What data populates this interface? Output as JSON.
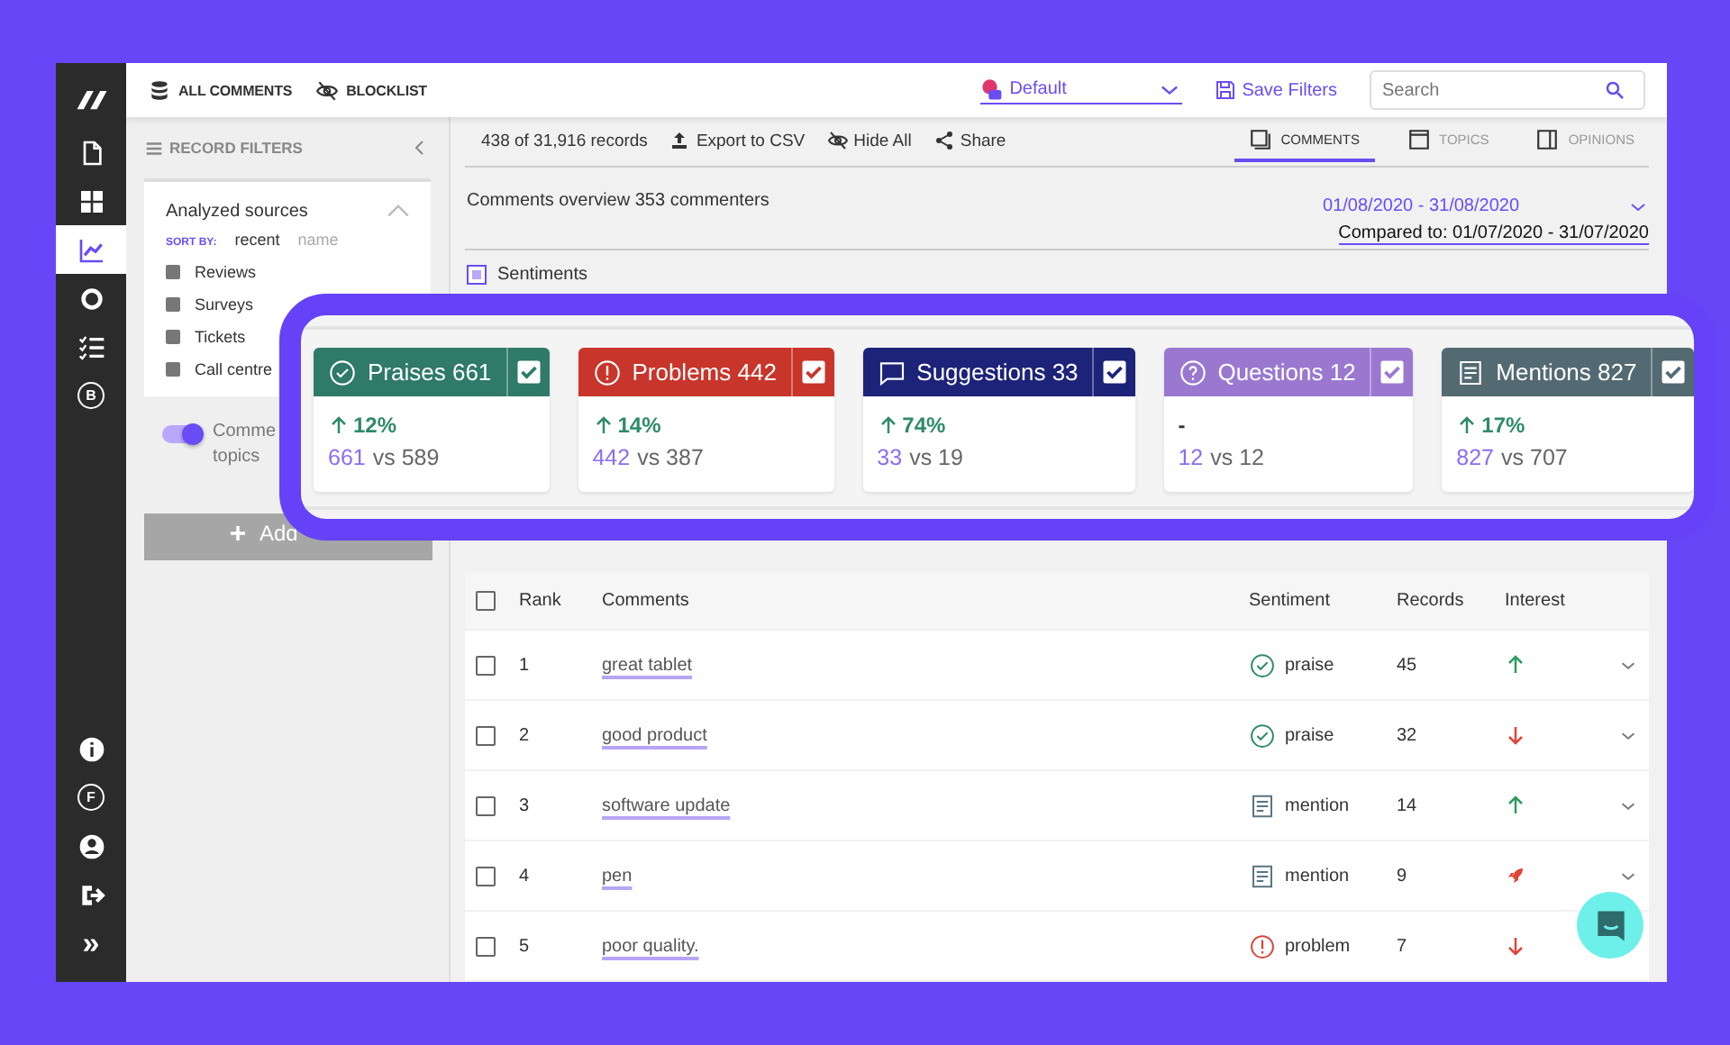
{
  "nav": {
    "top": [
      {
        "kind": "logo",
        "selected": false
      },
      {
        "kind": "document",
        "selected": false
      },
      {
        "kind": "grid",
        "selected": false
      },
      {
        "kind": "chart",
        "selected": true
      },
      {
        "kind": "ring",
        "selected": false
      },
      {
        "kind": "checklist",
        "selected": false
      },
      {
        "kind": "letter",
        "letter": "B",
        "selected": false
      }
    ],
    "bottom": [
      {
        "kind": "info",
        "selected": false
      },
      {
        "kind": "letter",
        "letter": "F",
        "selected": false
      },
      {
        "kind": "user",
        "selected": false
      },
      {
        "kind": "logout",
        "selected": false
      },
      {
        "kind": "text",
        "text": "»",
        "selected": false
      }
    ]
  },
  "topbar": {
    "links": [
      {
        "kind": "database",
        "label": "ALL COMMENTS"
      },
      {
        "kind": "eye-off",
        "label": "BLOCKLIST"
      }
    ],
    "profile": "Default",
    "save": "Save Filters",
    "search": {
      "placeholder": "Search"
    }
  },
  "filters": {
    "title": "RECORD FILTERS",
    "sources": {
      "title": "Analyzed sources",
      "expanded": true,
      "sort_label": "SORT BY:",
      "sort_options": [
        {
          "label": "recent",
          "selected": true
        },
        {
          "label": "name",
          "selected": false
        }
      ],
      "items": [
        {
          "label": "Reviews",
          "checked": false
        },
        {
          "label": "Surveys",
          "checked": false
        },
        {
          "label": "Tickets",
          "checked": false
        },
        {
          "label": "Call centre",
          "checked": false
        }
      ]
    },
    "toggle": {
      "label": "Comme\ntopics",
      "on": true
    },
    "add_button": "Add"
  },
  "toolbar": {
    "records": "438 of 31,916 records",
    "actions": [
      {
        "kind": "export",
        "label": "Export to CSV"
      },
      {
        "kind": "eye-off",
        "label": "Hide All"
      },
      {
        "kind": "share",
        "label": "Share"
      }
    ],
    "tabs": [
      {
        "kind": "comments",
        "label": "COMMENTS",
        "selected": true
      },
      {
        "kind": "topics",
        "label": "TOPICS",
        "selected": false
      },
      {
        "kind": "opinions",
        "label": "OPINIONS",
        "selected": false
      }
    ]
  },
  "overview": {
    "title": "Comments overview 353 commenters",
    "period": "01/08/2020 - 31/08/2020",
    "compared": "Compared to: 01/07/2020 - 31/07/2020"
  },
  "sentiments": {
    "label": "Sentiments",
    "checked": true,
    "cards": [
      {
        "kind": "praise",
        "label": "Praises 661",
        "color": "#2f7a68",
        "checked": true,
        "trend": {
          "kind": "up"
        },
        "change": "12%",
        "current": "661",
        "previous": "vs 589"
      },
      {
        "kind": "problem",
        "label": "Problems 442",
        "color": "#c8352b",
        "checked": true,
        "trend": {
          "kind": "up"
        },
        "change": "14%",
        "current": "442",
        "previous": "vs 387"
      },
      {
        "kind": "suggestion",
        "label": "Suggestions 33",
        "color": "#1c2378",
        "checked": true,
        "trend": {
          "kind": "up"
        },
        "change": "74%",
        "current": "33",
        "previous": "vs 19"
      },
      {
        "kind": "question",
        "label": "Questions 12",
        "color": "#9a78d0",
        "checked": true,
        "change": "-",
        "current": "12",
        "previous": "vs 12"
      },
      {
        "kind": "mention",
        "label": "Mentions 827",
        "color": "#546a72",
        "checked": true,
        "trend": {
          "kind": "up"
        },
        "change": "17%",
        "current": "827",
        "previous": "vs 707"
      }
    ]
  },
  "table": {
    "columns": [
      "Rank",
      "Comments",
      "Sentiment",
      "Records",
      "Interest"
    ],
    "all_checked": false,
    "rows": [
      {
        "rank": "1",
        "comment": "great tablet",
        "kind": "praise",
        "sentiment": "praise",
        "records": "45",
        "interest": {
          "kind": "up"
        },
        "checked": false
      },
      {
        "rank": "2",
        "comment": "good product",
        "kind": "praise",
        "sentiment": "praise",
        "records": "32",
        "interest": {
          "kind": "down"
        },
        "checked": false
      },
      {
        "rank": "3",
        "comment": "software update",
        "kind": "mention",
        "sentiment": "mention",
        "records": "14",
        "interest": {
          "kind": "up"
        },
        "checked": false
      },
      {
        "rank": "4",
        "comment": "pen",
        "kind": "mention",
        "sentiment": "mention",
        "records": "9",
        "interest": {
          "kind": "rocket"
        },
        "checked": false
      },
      {
        "rank": "5",
        "comment": "poor quality.",
        "kind": "problem",
        "sentiment": "problem",
        "records": "7",
        "interest": {
          "kind": "down"
        },
        "checked": false
      }
    ]
  }
}
